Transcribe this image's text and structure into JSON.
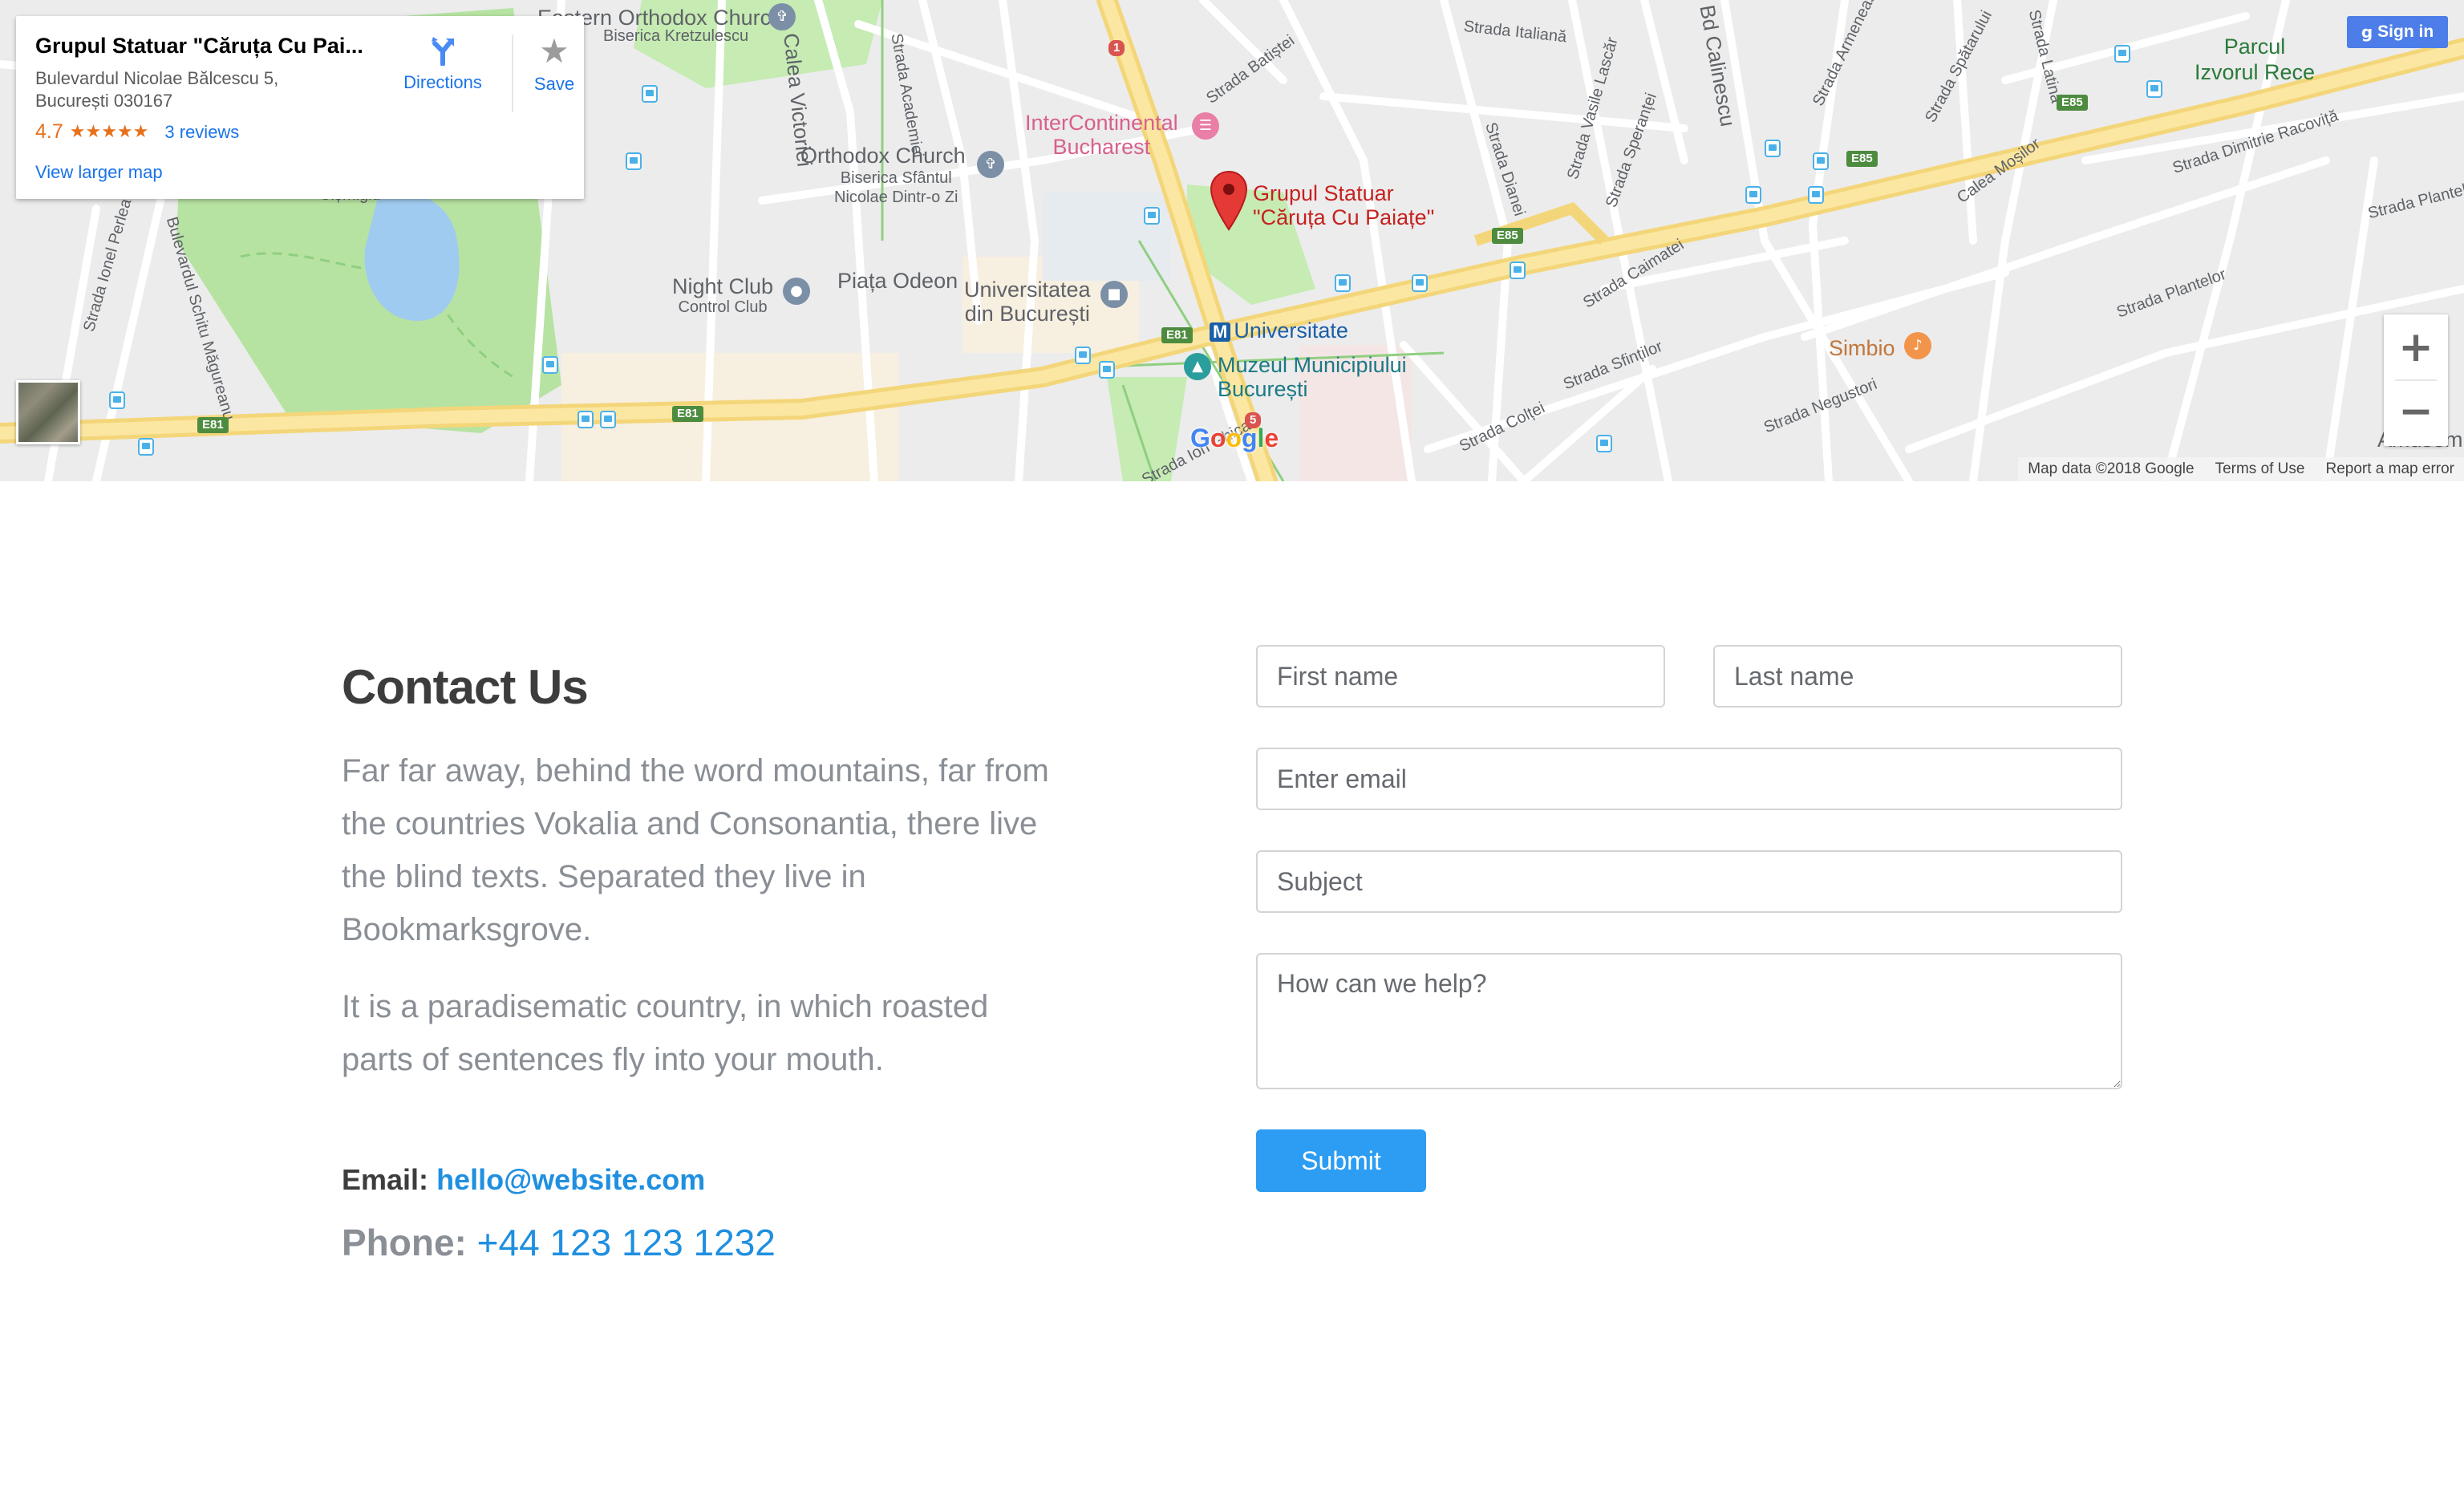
{
  "map": {
    "info_card": {
      "title": "Grupul Statuar \"Căruța Cu Pai...",
      "address_line1": "Bulevardul Nicolae Bălcescu 5,",
      "address_line2": "București 030167",
      "rating": "4.7",
      "stars": "★★★★★",
      "stars_value": 4.7,
      "reviews": "3 reviews",
      "view_larger": "View larger map",
      "directions": "Directions",
      "save": "Save"
    },
    "sign_in": "Sign in",
    "zoom_in": "+",
    "zoom_out": "−",
    "google": [
      "G",
      "o",
      "o",
      "g",
      "l",
      "e"
    ],
    "attribution": {
      "data": "Map data ©2018 Google",
      "terms": "Terms of Use",
      "report": "Report a map error"
    },
    "labels": {
      "orthodox_church_top": "Orthodox Church",
      "eastern_partial": "Eastern",
      "biserica_kretzulescu": "Biserica Kretzulescu",
      "calea_victoriei": "Calea Victoriei",
      "strada_academiei": "Strada Academiei",
      "strada_batistei": "Strada Batiștei",
      "strada_italiana": "Strada Italiană",
      "strada_calinescu": "Bd Calinescu",
      "strada_armeneasca": "Strada Armenească",
      "strada_spatarului": "Strada Spătarului",
      "strada_latina": "Strada Latină",
      "parcul": "Parcul",
      "izvorul_rece": "Izvorul Rece",
      "intercontinental_1": "InterContinental",
      "intercontinental_2": "Bucharest",
      "orthodox_church_mid": "Orthodox Church",
      "biserica_dintr_o_zi_1": "Biserica Sfântul",
      "biserica_dintr_o_zi_2": "Nicolae Dintr-o Zi",
      "pin_label_1": "Grupul Statuar",
      "pin_label_2": "\"Căruța Cu Paiațe\"",
      "strada_vasile_lascar": "Strada Vasile Lascăr",
      "strada_sperantei": "Strada Speranței",
      "strada_dianei": "Strada Dianei",
      "calea_mosilor": "Calea Moșilor",
      "strada_dimitrie_racovita": "Strada Dimitrie Racoviță",
      "strada_plantelor_right": "Strada Plantelor",
      "strada_ionel_perlea": "Strada Ionel Perlea",
      "bulevardul_schitu": "Bulevardul Schitu Măgureanu",
      "night_club_1": "Night Club",
      "night_club_2": "Control Club",
      "piata_odeon": "Piața Odeon",
      "universitatea_1": "Universitatea",
      "universitatea_2": "din București",
      "universitate_metro": "Universitate",
      "muzeul_1": "Muzeul Municipiului",
      "muzeul_2": "București",
      "strada_caimatei": "Strada Caimatei",
      "strada_plantelor": "Strada Plantelor",
      "simbio": "Simbio",
      "strada_sfintilor": "Strada Sfinților",
      "strada_coltei": "Strada Colței",
      "strada_negustori": "Strada Negustori",
      "strada_ion_ghica": "Strada Ion Ghica",
      "amusem": "Amusem",
      "cismigiu": "Cișmigiu",
      "e81": "E81",
      "e85": "E85",
      "route_1": "1",
      "route_5": "5"
    }
  },
  "contact": {
    "heading": "Contact Us",
    "para1": "Far far away, behind the word mountains, far from the countries Vokalia and Consonantia, there live the blind texts. Separated they live in Bookmarksgrove.",
    "para2": "It is a paradisematic country, in which roasted parts of sentences fly into your mouth.",
    "email_label": "Email:",
    "email_value": "hello@website.com",
    "phone_label": "Phone:",
    "phone_value": "+44 123 123 1232"
  },
  "form": {
    "first_name_placeholder": "First name",
    "last_name_placeholder": "Last name",
    "email_placeholder": "Enter email",
    "subject_placeholder": "Subject",
    "message_placeholder": "How can we help?",
    "submit_label": "Submit"
  },
  "colors": {
    "accent": "#2c9df2",
    "link": "#1f8fe0",
    "heading": "#3d3d3d",
    "body_text": "#8a8f96",
    "map_road_major": "#fbe08c",
    "map_park": "#b9e3a8",
    "map_water": "#9fcbf0",
    "pin": "#e53935"
  }
}
